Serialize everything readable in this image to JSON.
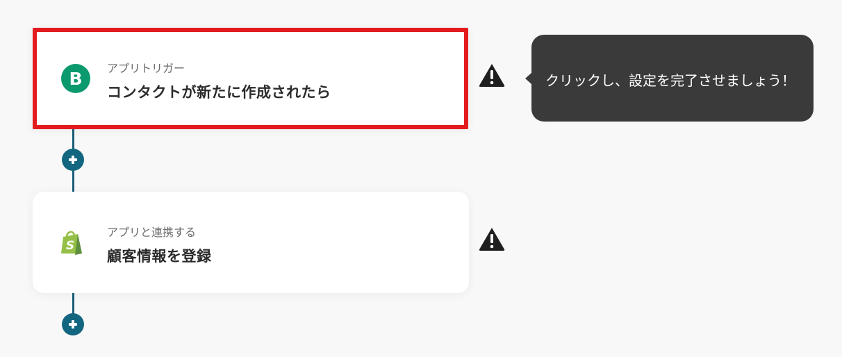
{
  "flow": {
    "steps": [
      {
        "kind": "trigger",
        "subtitle": "アプリトリガー",
        "title": "コンタクトが新たに作成されたら",
        "app_icon": "brevo-logo-icon",
        "selected": true,
        "highlight_color": "#e21b1f"
      },
      {
        "kind": "action",
        "subtitle": "アプリと連携する",
        "title": "顧客情報を登録",
        "app_icon": "shopify-logo-icon",
        "selected": false
      }
    ],
    "add_step_icon": "plus-circle-icon",
    "warning_icon": "warning-triangle-icon",
    "connector_color": "#1b5f78"
  },
  "tooltip": {
    "text": "クリックし、設定を完了させましょう！",
    "background": "#3a3a3a"
  },
  "colors": {
    "background": "#f8f8f8",
    "accent": "#136680",
    "brevo_green": "#0b996e",
    "shopify_green": "#95bf47"
  }
}
